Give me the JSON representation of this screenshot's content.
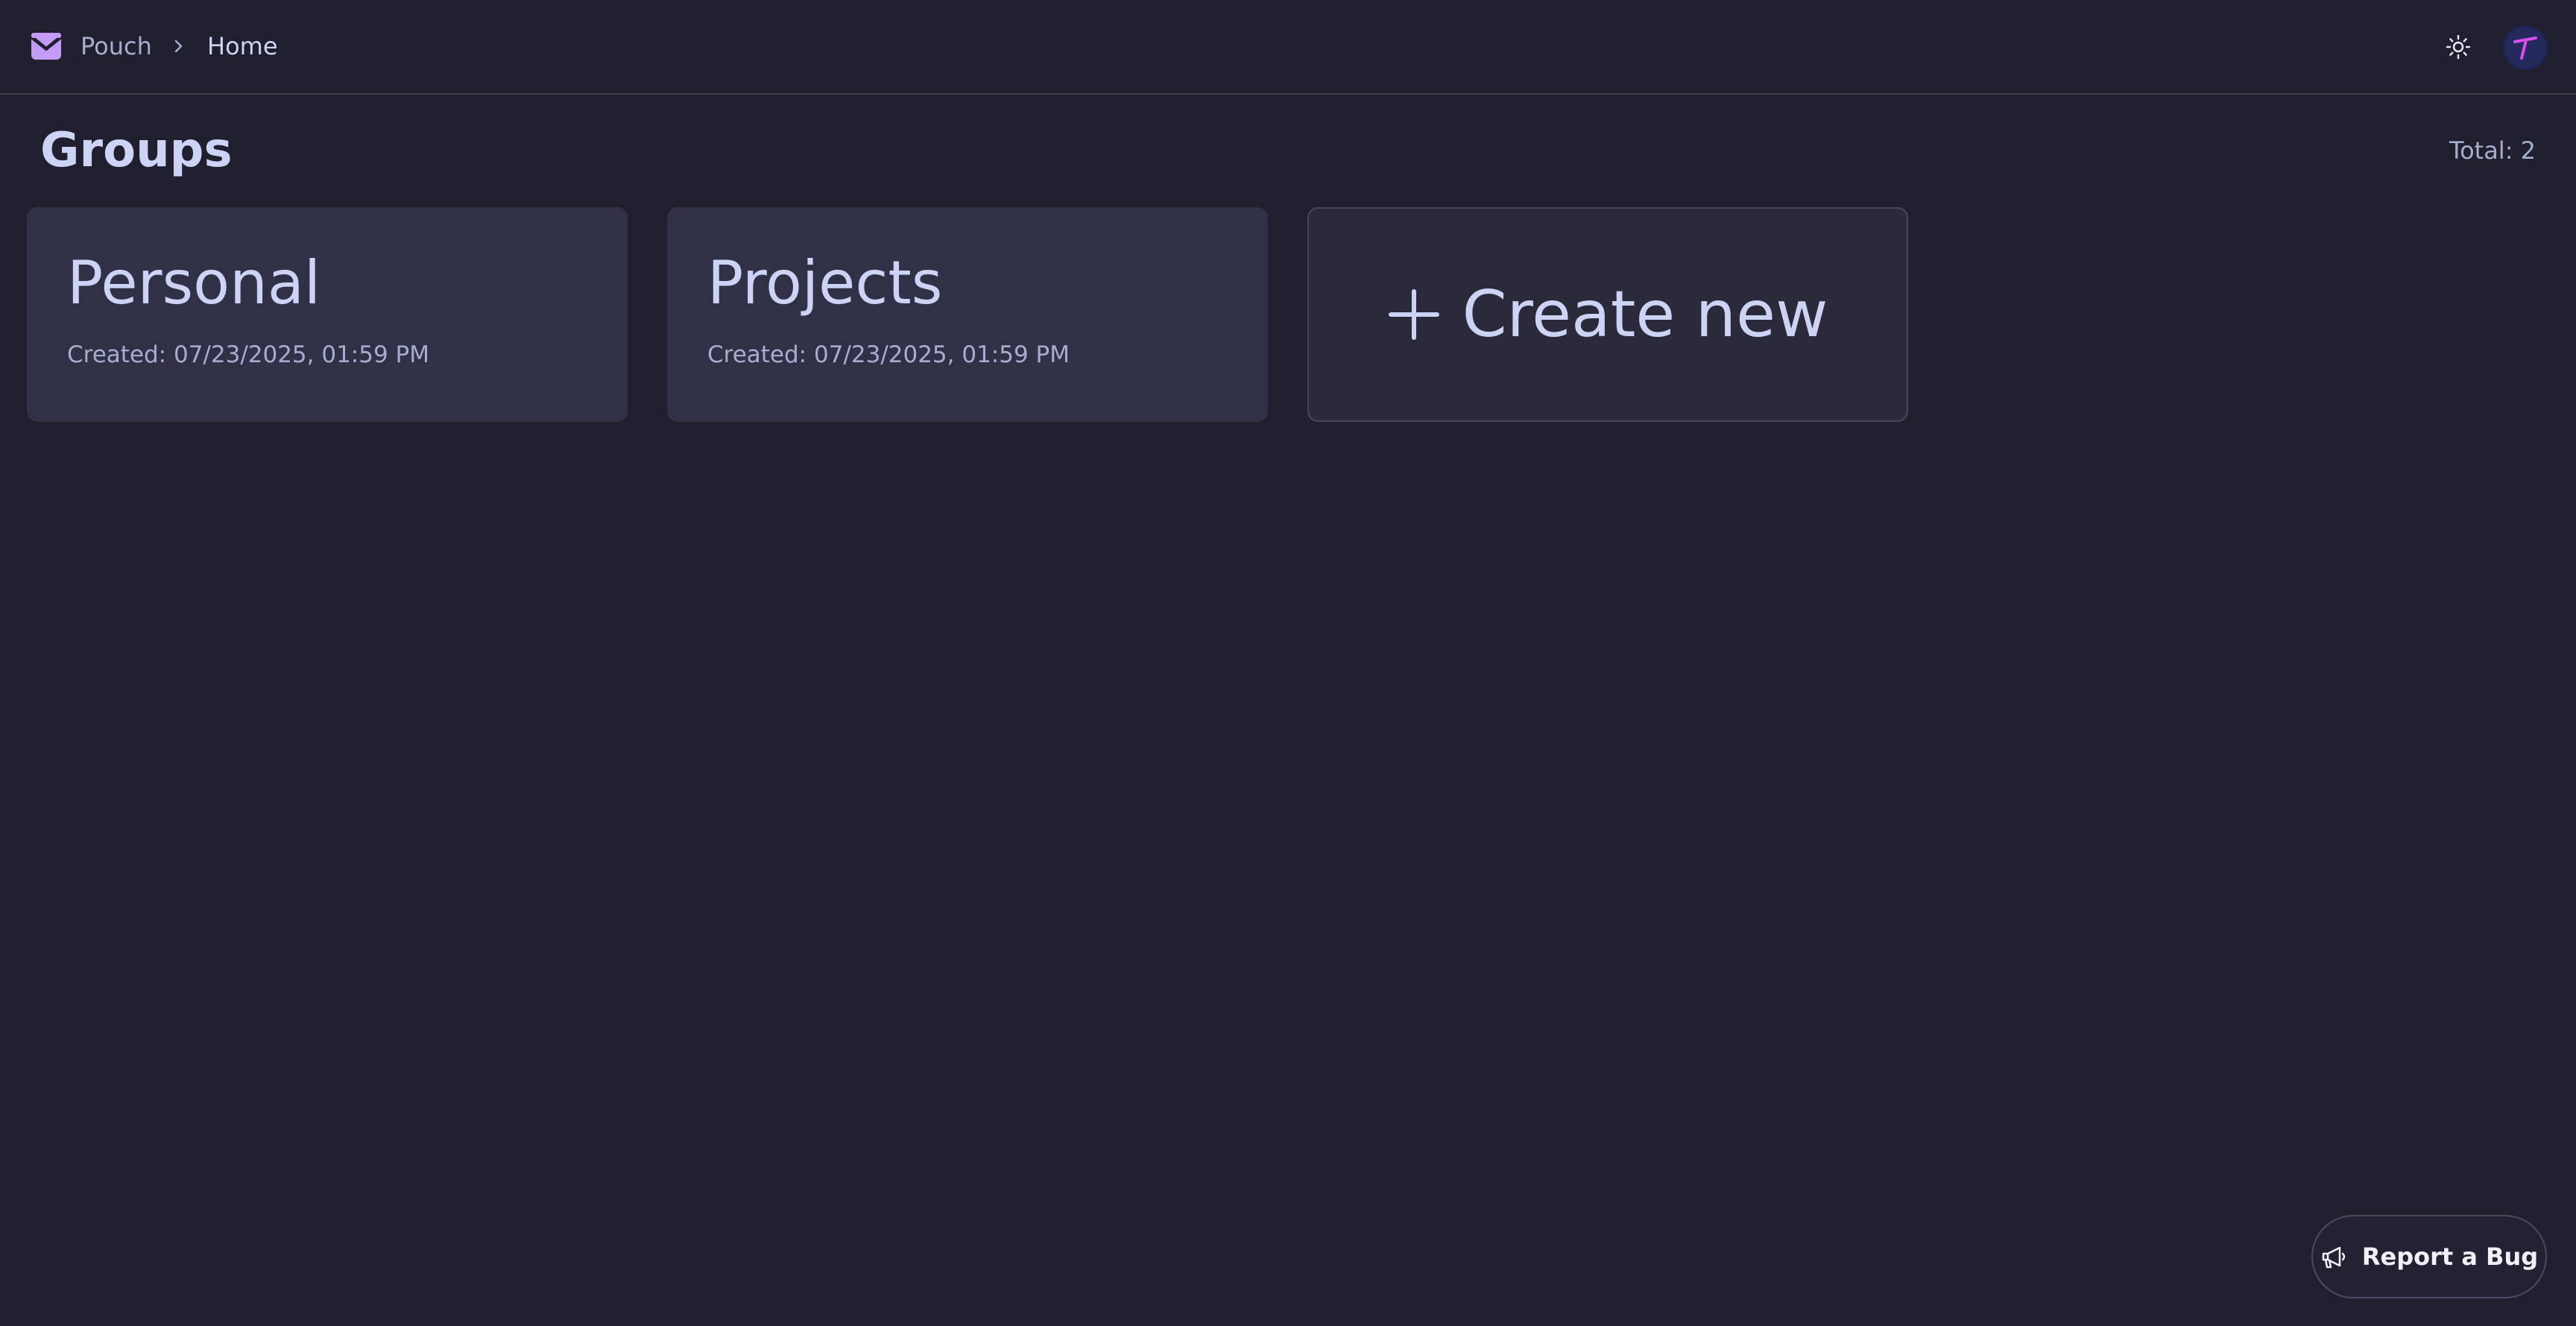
{
  "header": {
    "brand": "Pouch",
    "breadcrumb_current": "Home",
    "icons": {
      "brand": "envelope-icon",
      "separator": "chevron-right-icon",
      "theme": "sun-icon",
      "avatar": "user-avatar"
    }
  },
  "main": {
    "title": "Groups",
    "total": "Total: 2",
    "groups": [
      {
        "name": "Personal",
        "created": "Created: 07/23/2025, 01:59 PM"
      },
      {
        "name": "Projects",
        "created": "Created: 07/23/2025, 01:59 PM"
      }
    ],
    "create_label": "Create new"
  },
  "footer": {
    "report_bug_label": "Report a Bug"
  },
  "colors": {
    "background": "#1f1f2e",
    "card": "#303146",
    "text": "#cdd3f5",
    "muted": "#a7adce",
    "brand_accent": "#c39bf2",
    "avatar_accent": "#d94cf0"
  }
}
